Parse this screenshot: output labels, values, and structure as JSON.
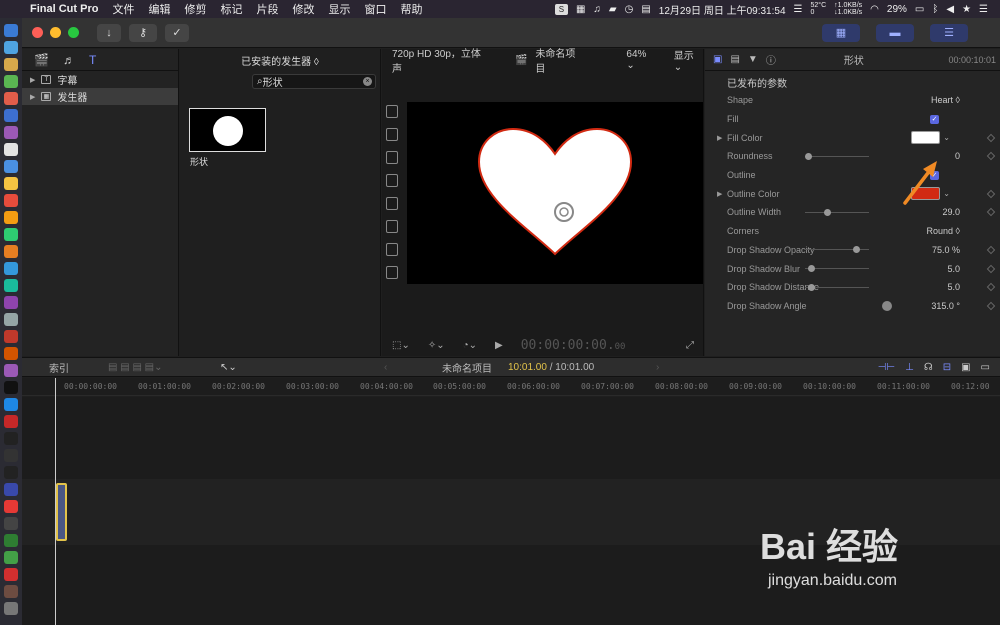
{
  "menubar": {
    "app_name": "Final Cut Pro",
    "menus": [
      "文件",
      "编辑",
      "修剪",
      "标记",
      "片段",
      "修改",
      "显示",
      "窗口",
      "帮助"
    ],
    "temperature": "52°C",
    "net_up": "↑1.0KB/s",
    "net_down": "↓1.0KB/s",
    "cpu_a": "0",
    "cpu_b": "0",
    "datetime": "12月29日 周日 上午09:31:54",
    "battery": "29%"
  },
  "libraries": {
    "items": [
      {
        "label": "字幕"
      },
      {
        "label": "发生器"
      }
    ]
  },
  "browser": {
    "title": "已安装的发生器 ◊",
    "search_value": "形状",
    "clear_glyph": "×",
    "thumbnail_label": "形状"
  },
  "viewer": {
    "format": "720p HD 30p，立体声",
    "project_name": "未命名项目",
    "zoom": "64% ⌄",
    "display": "显示 ⌄",
    "timecode": "00:00:00:00",
    "timecode_frames": "00"
  },
  "inspector": {
    "title": "形状",
    "timecode": "00:00:10:01",
    "section": "已发布的参数",
    "params": {
      "shape": {
        "label": "Shape",
        "value": "Heart ◊"
      },
      "fill": {
        "label": "Fill",
        "value": "✓"
      },
      "fill_color": {
        "label": "Fill Color",
        "color": "#ffffff"
      },
      "roundness": {
        "label": "Roundness",
        "value": "0",
        "level": 0.0
      },
      "outline": {
        "label": "Outline",
        "value": "✓"
      },
      "outline_color": {
        "label": "Outline Color",
        "color": "#d12a12"
      },
      "outline_width": {
        "label": "Outline Width",
        "value": "29.0",
        "level": 0.29
      },
      "corners": {
        "label": "Corners",
        "value": "Round ◊"
      },
      "shadow_opacity": {
        "label": "Drop Shadow Opacity",
        "value": "75.0  %",
        "level": 0.75
      },
      "shadow_blur": {
        "label": "Drop Shadow Blur",
        "value": "5.0",
        "level": 0.05
      },
      "shadow_dist": {
        "label": "Drop Shadow Distance",
        "value": "5.0",
        "level": 0.05
      },
      "shadow_angle": {
        "label": "Drop Shadow Angle",
        "value": "315.0 °"
      }
    }
  },
  "timeline": {
    "index_label": "索引",
    "project_name": "未命名项目",
    "current_time": "10:01.00",
    "total_time": " / 10:01.00",
    "ruler": [
      "00:00:00:00",
      "00:01:00:00",
      "00:02:00:00",
      "00:03:00:00",
      "00:04:00:00",
      "00:05:00:00",
      "00:06:00:00",
      "00:07:00:00",
      "00:08:00:00",
      "00:09:00:00",
      "00:10:00:00",
      "00:11:00:00",
      "00:12:00"
    ]
  },
  "watermark": {
    "logo": "Bai  经验",
    "url": "jingyan.baidu.com"
  },
  "colors": {
    "accent": "#5a67e0",
    "clip_border": "#e2c34a",
    "heart_outline": "#d12a12",
    "arrow": "#f08a24"
  }
}
